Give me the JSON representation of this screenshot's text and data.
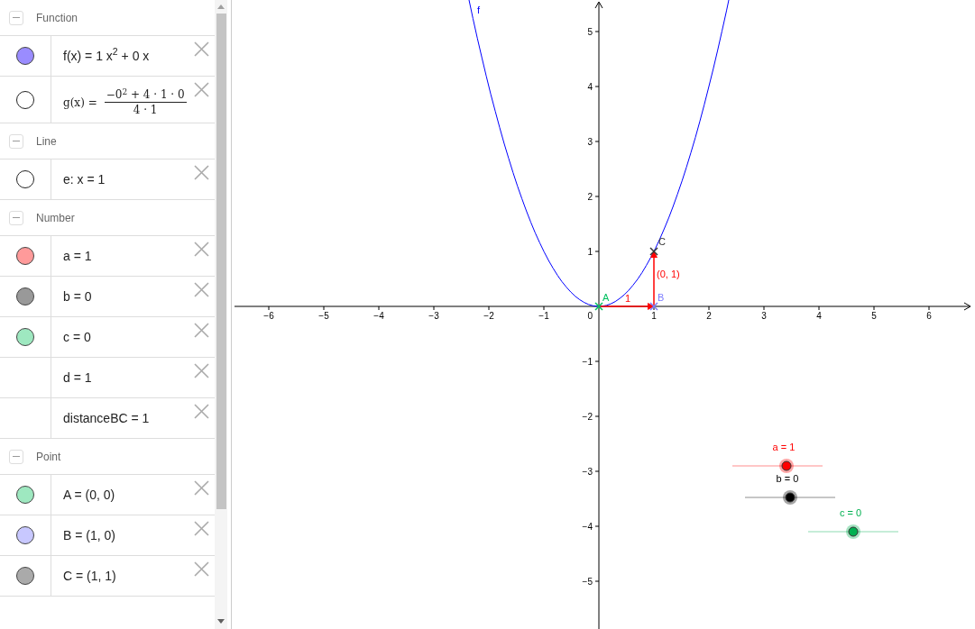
{
  "algebra": {
    "groups": [
      {
        "title": "Function",
        "items": [
          {
            "kind": "object",
            "visible": true,
            "color": "#9a8cff",
            "formula": "f(x) = 1 x$^{2}$ + 0 x"
          },
          {
            "kind": "object",
            "visible": false,
            "fraction": {
              "lhs": "g(x) =",
              "numerator": "−0$^{2}$ + 4 · 1 · 0",
              "denominator": "4 · 1"
            }
          }
        ]
      },
      {
        "title": "Line",
        "items": [
          {
            "kind": "object",
            "visible": false,
            "formula": "e: x = 1"
          }
        ]
      },
      {
        "title": "Number",
        "items": [
          {
            "kind": "object",
            "visible": true,
            "color": "#ff9a9a",
            "formula": "a = 1"
          },
          {
            "kind": "object",
            "visible": true,
            "color": "#999999",
            "formula": "b = 0"
          },
          {
            "kind": "object",
            "visible": true,
            "color": "#9ee8c0",
            "formula": "c = 0"
          },
          {
            "kind": "plain",
            "formula": "d = 1"
          },
          {
            "kind": "plain",
            "formula": "distanceBC = 1"
          }
        ]
      },
      {
        "title": "Point",
        "items": [
          {
            "kind": "object",
            "visible": true,
            "color": "#9ee8c0",
            "formula": "A = (0, 0)"
          },
          {
            "kind": "object",
            "visible": true,
            "color": "#c8c8ff",
            "formula": "B = (1, 0)"
          },
          {
            "kind": "object",
            "visible": true,
            "color": "#aaaaaa",
            "formula": "C = (1, 1)"
          }
        ]
      }
    ]
  },
  "graphics": {
    "origin_label": "0",
    "x_labels": [
      "−6",
      "−5",
      "−4",
      "−3",
      "−2",
      "−1",
      "1",
      "2",
      "3",
      "4",
      "5",
      "6"
    ],
    "y_labels": [
      "5",
      "4",
      "3",
      "2",
      "1",
      "−1",
      "−2",
      "−3",
      "−4",
      "−5"
    ],
    "curve_label": "f",
    "points": [
      {
        "label": "A",
        "color": "#00c060"
      },
      {
        "label": "B",
        "color": "#7b7bff"
      },
      {
        "label": "C",
        "color": "#333333"
      }
    ],
    "vectors": [
      {
        "label": "1"
      },
      {
        "label": "(0, 1)"
      }
    ],
    "sliders": [
      {
        "label": "a = 1",
        "color": "#ff0000",
        "level": 0.6
      },
      {
        "label": "b = 0",
        "color": "#000000",
        "level": 0.5
      },
      {
        "label": "c = 0",
        "color": "#00b050",
        "level": 0.5
      }
    ]
  }
}
